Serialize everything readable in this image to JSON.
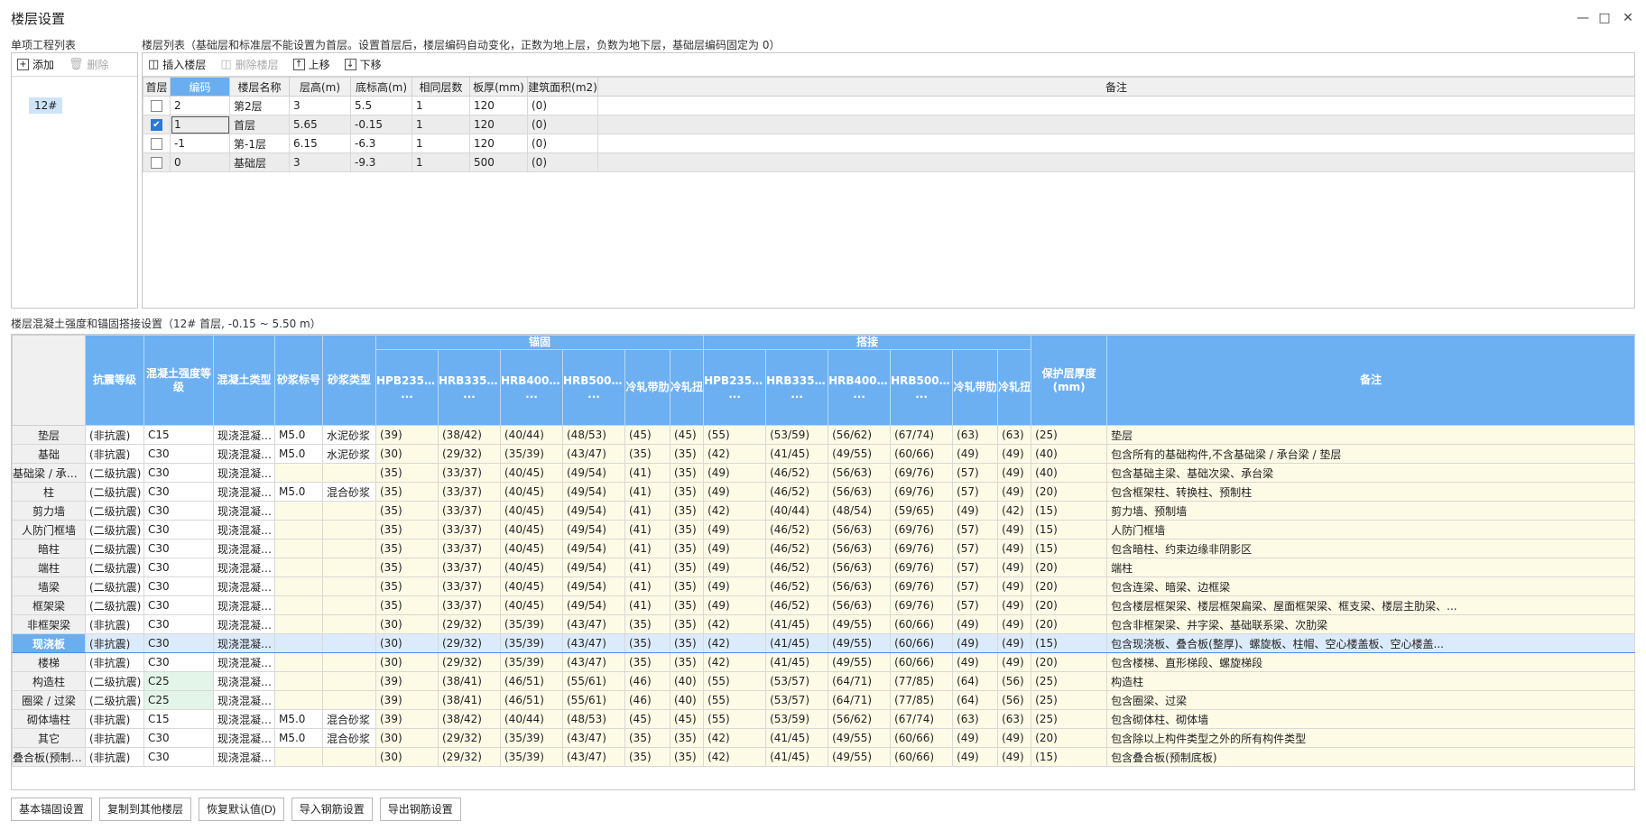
{
  "window": {
    "title": "楼层设置"
  },
  "left_panel": {
    "label": "单项工程列表",
    "add": "添加",
    "delete": "删除",
    "project": "12#"
  },
  "floor_panel": {
    "label": "楼层列表（基础层和标准层不能设置为首层。设置首层后，楼层编码自动变化，正数为地上层，负数为地下层，基础层编码固定为 0）",
    "toolbar": {
      "insert": "插入楼层",
      "delete": "删除楼层",
      "up": "上移",
      "down": "下移"
    },
    "columns": [
      "首层",
      "编码",
      "楼层名称",
      "层高(m)",
      "底标高(m)",
      "相同层数",
      "板厚(mm)",
      "建筑面积(m2)",
      "备注"
    ],
    "rows": [
      {
        "first": false,
        "code": "2",
        "name": "第2层",
        "height": "3",
        "bottom": "5.5",
        "same": "1",
        "slab": "120",
        "area": "(0)",
        "note": ""
      },
      {
        "first": true,
        "code": "1",
        "name": "首层",
        "height": "5.65",
        "bottom": "-0.15",
        "same": "1",
        "slab": "120",
        "area": "(0)",
        "note": ""
      },
      {
        "first": false,
        "code": "-1",
        "name": "第-1层",
        "height": "6.15",
        "bottom": "-6.3",
        "same": "1",
        "slab": "120",
        "area": "(0)",
        "note": ""
      },
      {
        "first": false,
        "code": "0",
        "name": "基础层",
        "height": "3",
        "bottom": "-9.3",
        "same": "1",
        "slab": "500",
        "area": "(0)",
        "note": ""
      }
    ]
  },
  "concrete_panel": {
    "label": "楼层混凝土强度和锚固搭接设置（12# 首层, -0.15 ~ 5.50 m）",
    "group_anchor": "锚固",
    "group_lap": "搭接",
    "col_seismic": "抗震等级",
    "col_grade": "混凝土强度等级",
    "col_ctype": "混凝土类型",
    "col_mortar": "砂浆标号",
    "col_mtype": "砂浆类型",
    "bar_cols": [
      "HPB235(A)\n...",
      "HRB335(B)\n...",
      "HRB400(C)\n...",
      "HRB500(E)\n...",
      "冷轧带肋",
      "冷轧扭"
    ],
    "col_cover": "保护层厚度(mm)",
    "col_note": "备注",
    "rows": [
      {
        "name": "垫层",
        "seismic": "(非抗震)",
        "grade": "C15",
        "ctype": "现浇混凝土...",
        "mortar": "M5.0",
        "mtype": "水泥砂浆",
        "a": [
          "(39)",
          "(38/42)",
          "(40/44)",
          "(48/53)",
          "(45)",
          "(45)"
        ],
        "l": [
          "(55)",
          "(53/59)",
          "(56/62)",
          "(67/74)",
          "(63)",
          "(63)"
        ],
        "cover": "(25)",
        "note": "垫层"
      },
      {
        "name": "基础",
        "seismic": "(非抗震)",
        "grade": "C30",
        "ctype": "现浇混凝土...",
        "mortar": "M5.0",
        "mtype": "水泥砂浆",
        "a": [
          "(30)",
          "(29/32)",
          "(35/39)",
          "(43/47)",
          "(35)",
          "(35)"
        ],
        "l": [
          "(42)",
          "(41/45)",
          "(49/55)",
          "(60/66)",
          "(49)",
          "(49)"
        ],
        "cover": "(40)",
        "note": "包含所有的基础构件,不含基础梁 / 承台梁 / 垫层"
      },
      {
        "name": "基础梁 / 承台梁",
        "seismic": "(二级抗震)",
        "grade": "C30",
        "ctype": "现浇混凝土...",
        "mortar": "",
        "mtype": "",
        "a": [
          "(35)",
          "(33/37)",
          "(40/45)",
          "(49/54)",
          "(41)",
          "(35)"
        ],
        "l": [
          "(49)",
          "(46/52)",
          "(56/63)",
          "(69/76)",
          "(57)",
          "(49)"
        ],
        "cover": "(40)",
        "note": "包含基础主梁、基础次梁、承台梁"
      },
      {
        "name": "柱",
        "seismic": "(二级抗震)",
        "grade": "C30",
        "ctype": "现浇混凝土...",
        "mortar": "M5.0",
        "mtype": "混合砂浆",
        "a": [
          "(35)",
          "(33/37)",
          "(40/45)",
          "(49/54)",
          "(41)",
          "(35)"
        ],
        "l": [
          "(49)",
          "(46/52)",
          "(56/63)",
          "(69/76)",
          "(57)",
          "(49)"
        ],
        "cover": "(20)",
        "note": "包含框架柱、转换柱、预制柱"
      },
      {
        "name": "剪力墙",
        "seismic": "(二级抗震)",
        "grade": "C30",
        "ctype": "现浇混凝土...",
        "mortar": "",
        "mtype": "",
        "a": [
          "(35)",
          "(33/37)",
          "(40/45)",
          "(49/54)",
          "(41)",
          "(35)"
        ],
        "l": [
          "(42)",
          "(40/44)",
          "(48/54)",
          "(59/65)",
          "(49)",
          "(42)"
        ],
        "cover": "(15)",
        "note": "剪力墙、预制墙"
      },
      {
        "name": "人防门框墙",
        "seismic": "(二级抗震)",
        "grade": "C30",
        "ctype": "现浇混凝土...",
        "mortar": "",
        "mtype": "",
        "a": [
          "(35)",
          "(33/37)",
          "(40/45)",
          "(49/54)",
          "(41)",
          "(35)"
        ],
        "l": [
          "(49)",
          "(46/52)",
          "(56/63)",
          "(69/76)",
          "(57)",
          "(49)"
        ],
        "cover": "(15)",
        "note": "人防门框墙"
      },
      {
        "name": "暗柱",
        "seismic": "(二级抗震)",
        "grade": "C30",
        "ctype": "现浇混凝土...",
        "mortar": "",
        "mtype": "",
        "a": [
          "(35)",
          "(33/37)",
          "(40/45)",
          "(49/54)",
          "(41)",
          "(35)"
        ],
        "l": [
          "(49)",
          "(46/52)",
          "(56/63)",
          "(69/76)",
          "(57)",
          "(49)"
        ],
        "cover": "(15)",
        "note": "包含暗柱、约束边缘非阴影区"
      },
      {
        "name": "端柱",
        "seismic": "(二级抗震)",
        "grade": "C30",
        "ctype": "现浇混凝土...",
        "mortar": "",
        "mtype": "",
        "a": [
          "(35)",
          "(33/37)",
          "(40/45)",
          "(49/54)",
          "(41)",
          "(35)"
        ],
        "l": [
          "(49)",
          "(46/52)",
          "(56/63)",
          "(69/76)",
          "(57)",
          "(49)"
        ],
        "cover": "(20)",
        "note": "端柱"
      },
      {
        "name": "墙梁",
        "seismic": "(二级抗震)",
        "grade": "C30",
        "ctype": "现浇混凝土...",
        "mortar": "",
        "mtype": "",
        "a": [
          "(35)",
          "(33/37)",
          "(40/45)",
          "(49/54)",
          "(41)",
          "(35)"
        ],
        "l": [
          "(49)",
          "(46/52)",
          "(56/63)",
          "(69/76)",
          "(57)",
          "(49)"
        ],
        "cover": "(20)",
        "note": "包含连梁、暗梁、边框梁"
      },
      {
        "name": "框架梁",
        "seismic": "(二级抗震)",
        "grade": "C30",
        "ctype": "现浇混凝土...",
        "mortar": "",
        "mtype": "",
        "a": [
          "(35)",
          "(33/37)",
          "(40/45)",
          "(49/54)",
          "(41)",
          "(35)"
        ],
        "l": [
          "(49)",
          "(46/52)",
          "(56/63)",
          "(69/76)",
          "(57)",
          "(49)"
        ],
        "cover": "(20)",
        "note": "包含楼层框架梁、楼层框架扁梁、屋面框架梁、框支梁、楼层主肋梁、..."
      },
      {
        "name": "非框架梁",
        "seismic": "(非抗震)",
        "grade": "C30",
        "ctype": "现浇混凝土...",
        "mortar": "",
        "mtype": "",
        "a": [
          "(30)",
          "(29/32)",
          "(35/39)",
          "(43/47)",
          "(35)",
          "(35)"
        ],
        "l": [
          "(42)",
          "(41/45)",
          "(49/55)",
          "(60/66)",
          "(49)",
          "(49)"
        ],
        "cover": "(20)",
        "note": "包含非框架梁、井字梁、基础联系梁、次肋梁"
      },
      {
        "name": "现浇板",
        "seismic": "(非抗震)",
        "grade": "C30",
        "ctype": "现浇混凝土...",
        "mortar": "",
        "mtype": "",
        "a": [
          "(30)",
          "(29/32)",
          "(35/39)",
          "(43/47)",
          "(35)",
          "(35)"
        ],
        "l": [
          "(42)",
          "(41/45)",
          "(49/55)",
          "(60/66)",
          "(49)",
          "(49)"
        ],
        "cover": "(15)",
        "note": "包含现浇板、叠合板(整厚)、螺旋板、柱帽、空心楼盖板、空心楼盖..."
      },
      {
        "name": "楼梯",
        "seismic": "(非抗震)",
        "grade": "C30",
        "ctype": "现浇混凝土...",
        "mortar": "",
        "mtype": "",
        "a": [
          "(30)",
          "(29/32)",
          "(35/39)",
          "(43/47)",
          "(35)",
          "(35)"
        ],
        "l": [
          "(42)",
          "(41/45)",
          "(49/55)",
          "(60/66)",
          "(49)",
          "(49)"
        ],
        "cover": "(20)",
        "note": "包含楼梯、直形梯段、螺旋梯段"
      },
      {
        "name": "构造柱",
        "seismic": "(二级抗震)",
        "grade": "C25",
        "ctype": "现浇混凝土...",
        "mortar": "",
        "mtype": "",
        "a": [
          "(39)",
          "(38/41)",
          "(46/51)",
          "(55/61)",
          "(46)",
          "(40)"
        ],
        "l": [
          "(55)",
          "(53/57)",
          "(64/71)",
          "(77/85)",
          "(64)",
          "(56)"
        ],
        "cover": "(25)",
        "note": "构造柱"
      },
      {
        "name": "圈梁 / 过梁",
        "seismic": "(二级抗震)",
        "grade": "C25",
        "ctype": "现浇混凝土...",
        "mortar": "",
        "mtype": "",
        "a": [
          "(39)",
          "(38/41)",
          "(46/51)",
          "(55/61)",
          "(46)",
          "(40)"
        ],
        "l": [
          "(55)",
          "(53/57)",
          "(64/71)",
          "(77/85)",
          "(64)",
          "(56)"
        ],
        "cover": "(25)",
        "note": "包含圈梁、过梁"
      },
      {
        "name": "砌体墙柱",
        "seismic": "(非抗震)",
        "grade": "C15",
        "ctype": "现浇混凝土...",
        "mortar": "M5.0",
        "mtype": "混合砂浆",
        "a": [
          "(39)",
          "(38/42)",
          "(40/44)",
          "(48/53)",
          "(45)",
          "(45)"
        ],
        "l": [
          "(55)",
          "(53/59)",
          "(56/62)",
          "(67/74)",
          "(63)",
          "(63)"
        ],
        "cover": "(25)",
        "note": "包含砌体柱、砌体墙"
      },
      {
        "name": "其它",
        "seismic": "(非抗震)",
        "grade": "C30",
        "ctype": "现浇混凝土...",
        "mortar": "M5.0",
        "mtype": "混合砂浆",
        "a": [
          "(30)",
          "(29/32)",
          "(35/39)",
          "(43/47)",
          "(35)",
          "(35)"
        ],
        "l": [
          "(42)",
          "(41/45)",
          "(49/55)",
          "(60/66)",
          "(49)",
          "(49)"
        ],
        "cover": "(20)",
        "note": "包含除以上构件类型之外的所有构件类型"
      },
      {
        "name": "叠合板(预制底板)",
        "seismic": "(非抗震)",
        "grade": "C30",
        "ctype": "现浇混凝土...",
        "mortar": "",
        "mtype": "",
        "a": [
          "(30)",
          "(29/32)",
          "(35/39)",
          "(43/47)",
          "(35)",
          "(35)"
        ],
        "l": [
          "(42)",
          "(41/45)",
          "(49/55)",
          "(60/66)",
          "(49)",
          "(49)"
        ],
        "cover": "(15)",
        "note": "包含叠合板(预制底板)"
      }
    ]
  },
  "buttons": [
    "基本锚固设置",
    "复制到其他楼层",
    "恢复默认值(D)",
    "导入钢筋设置",
    "导出钢筋设置"
  ]
}
